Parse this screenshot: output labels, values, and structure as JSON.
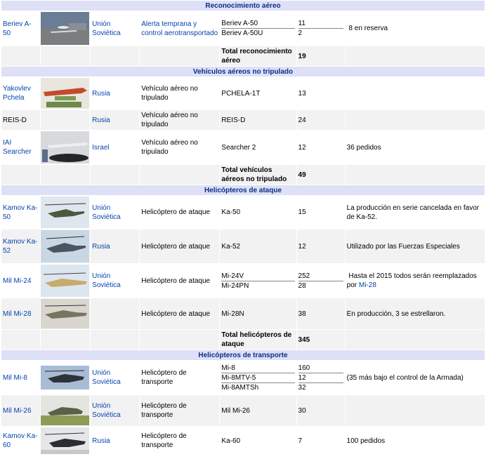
{
  "sections": {
    "recon": "Reconocimiento aéreo",
    "uav": "Vehículos aéreos no tripulado",
    "attack": "Helicópteros de ataque",
    "transport": "Helicópteros de transporte"
  },
  "rows": {
    "a50": {
      "name": "Beriev A-50",
      "country": "Unión Soviética",
      "role": "Alerta temprana y control aerotransportado",
      "v1": "Beriev A-50",
      "n1": "11",
      "v2": "Beriev A-50U",
      "n2": "2",
      "notes": "8 en reserva"
    },
    "recon_total": {
      "label": "Total reconocimiento aéreo",
      "value": "19"
    },
    "pchela": {
      "name": "Yakovlev Pchela",
      "country": "Rusia",
      "role": "Vehículo aéreo no tripulado",
      "version": "PCHELA-1T",
      "n": "13"
    },
    "reis": {
      "name": "REIS-D",
      "country": "Rusia",
      "role": "Vehículo aéreo no tripulado",
      "version": "REIS-D",
      "n": "24"
    },
    "searcher": {
      "name": "IAI Searcher",
      "country": "Israel",
      "role": "Vehículo aéreo no tripulado",
      "version": "Searcher 2",
      "n": "12",
      "notes": "36 pedidos"
    },
    "uav_total": {
      "label": "Total vehículos aéreos no tripulado",
      "value": "49"
    },
    "ka50": {
      "name": "Kamov Ka-50",
      "country": "Unión Soviética",
      "role": "Helicóptero de ataque",
      "version": "Ka-50",
      "n": "15",
      "notes": "La producción en serie cancelada en favor de Ka-52."
    },
    "ka52": {
      "name": "Kamov Ka-52",
      "country": "Rusia",
      "role": "Helicóptero de ataque",
      "version": "Ka-52",
      "n": "12",
      "notes": "Utilizado por las Fuerzas Especiales"
    },
    "mi24": {
      "name": "Mil Mi-24",
      "country": "Unión Soviética",
      "role": "Helicóptero de ataque",
      "v1": "Mi-24V",
      "n1": "252",
      "v2": "Mi-24PN",
      "n2": "28",
      "notes_a": "Hasta el 2015 todos serán reemplazados por",
      "notes_link": "Mi-28"
    },
    "mi28": {
      "name": "Mil Mi-28",
      "version": "Mi-28N",
      "n": "38",
      "role": "Helicóptero de ataque",
      "notes": "En producción, 3 se estrellaron."
    },
    "attack_total": {
      "label": "Total helicópteros de ataque",
      "value": "345"
    },
    "mi8": {
      "name": "Mil Mi-8",
      "country": "Unión Soviética",
      "role": "Helicóptero de transporte",
      "v1": "Mi-8",
      "n1": "160",
      "v2": "Mi-8MTV-5",
      "n2": "12",
      "v3": "Mi-8AMTSh",
      "n3": "32",
      "notes": "(35 más bajo el control de la Armada)"
    },
    "mi26": {
      "name": "Mil Mi-26",
      "country": "Unión Soviética",
      "role": "Helicóptero de transporte",
      "version": "Mil Mi-26",
      "n": "30"
    },
    "ka60": {
      "name": "Kamov Ka-60",
      "country": "Rusia",
      "role": "Helicóptero de transporte",
      "version": "Ka-60",
      "n": "7",
      "notes": "100 pedidos"
    }
  }
}
